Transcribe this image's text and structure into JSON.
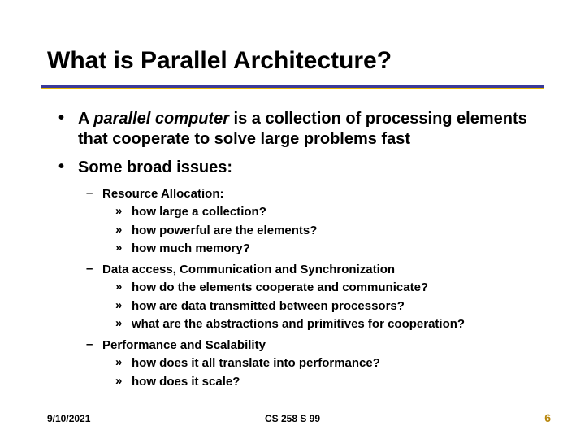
{
  "title": "What is Parallel Architecture?",
  "bullets": {
    "b1": {
      "pre": "A ",
      "em": "parallel computer",
      "post": " is a collection of processing elements that cooperate  to solve large problems fast"
    },
    "b2_text": "Some broad issues:",
    "sub1": {
      "head": "Resource Allocation:",
      "items": [
        "how large a collection?",
        "how powerful are the elements?",
        "how much memory?"
      ]
    },
    "sub2": {
      "head": "Data access, Communication and Synchronization",
      "items": [
        "how do the elements  cooperate and communicate?",
        "how are  data transmitted between processors?",
        "what are the abstractions and primitives for cooperation?"
      ]
    },
    "sub3": {
      "head": "Performance and Scalability",
      "items": [
        "how does it all translate into performance?",
        "how does it scale?"
      ]
    }
  },
  "footer": {
    "date": "9/10/2021",
    "course": "CS 258 S 99",
    "page": "6"
  }
}
